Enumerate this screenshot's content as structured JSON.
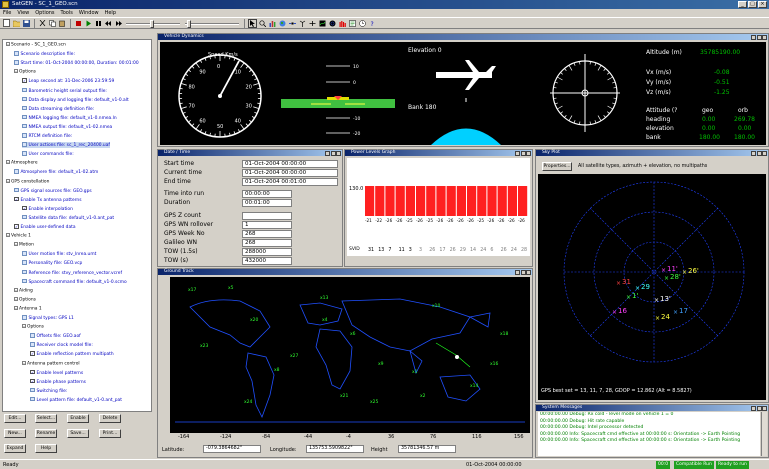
{
  "window": {
    "title": "SatGEN - SC_1_GEO.scn",
    "min": "_",
    "max": "□",
    "close": "×"
  },
  "menu": [
    "File",
    "View",
    "Options",
    "Tools",
    "Window",
    "Help"
  ],
  "tree": {
    "rows": [
      {
        "text": "Scenario - SC_1_GEO.scn",
        "indent": 0,
        "kind": "tw",
        "color": "black"
      },
      {
        "text": "Scenario description file:",
        "indent": 1,
        "kind": "leaf",
        "color": "blue"
      },
      {
        "text": "Start time: 01-Oct-2004 00:00:00, Duration: 00:01:00",
        "indent": 1,
        "kind": "leaf",
        "color": "blue"
      },
      {
        "text": "Options",
        "indent": 1,
        "kind": "tw",
        "color": "black"
      },
      {
        "text": "Leap second at: 31-Dec-2006 23:59:59",
        "indent": 2,
        "kind": "check",
        "color": "blue"
      },
      {
        "text": "Barometric height serial output file:",
        "indent": 2,
        "kind": "leaf",
        "color": "blue"
      },
      {
        "text": "Data display and logging file: default_v1-0.alt",
        "indent": 2,
        "kind": "leaf",
        "color": "blue"
      },
      {
        "text": "Data streaming definition file:",
        "indent": 2,
        "kind": "leaf",
        "color": "blue"
      },
      {
        "text": "NMEA logging file: default_v1-0.nmea.ln",
        "indent": 2,
        "kind": "leaf",
        "color": "blue"
      },
      {
        "text": "NMEA output file: default_v1-02.nmea",
        "indent": 2,
        "kind": "leaf",
        "color": "blue"
      },
      {
        "text": "RTCM definition file:",
        "indent": 2,
        "kind": "leaf",
        "color": "blue"
      },
      {
        "text": "User actions file: sc_1_rec_20400.uaf",
        "indent": 2,
        "kind": "leaf",
        "color": "blue",
        "hl": true
      },
      {
        "text": "User commands file:",
        "indent": 2,
        "kind": "leaf",
        "color": "blue"
      },
      {
        "text": "Atmosphere",
        "indent": 0,
        "kind": "tw",
        "color": "black"
      },
      {
        "text": "Atmosphere file: default_v1-02.atm",
        "indent": 1,
        "kind": "leaf",
        "color": "blue"
      },
      {
        "text": "GPS constellation",
        "indent": 0,
        "kind": "tw",
        "color": "black"
      },
      {
        "text": "GPS signal sources file: GEO.gps",
        "indent": 1,
        "kind": "leaf",
        "color": "blue"
      },
      {
        "text": "Enable Tx antenna patterns",
        "indent": 1,
        "kind": "check",
        "color": "blue"
      },
      {
        "text": "Enable interpolation",
        "indent": 2,
        "kind": "check",
        "color": "blue"
      },
      {
        "text": "Satellite data file: default_v1-0.ant_pat",
        "indent": 2,
        "kind": "leaf",
        "color": "blue"
      },
      {
        "text": "Enable user-defined data",
        "indent": 1,
        "kind": "check",
        "color": "blue"
      },
      {
        "text": "Vehicle 1",
        "indent": 0,
        "kind": "tw",
        "color": "black"
      },
      {
        "text": "Motion",
        "indent": 1,
        "kind": "tw",
        "color": "black"
      },
      {
        "text": "User motion file: stv_lnrea.umt",
        "indent": 2,
        "kind": "leaf",
        "color": "blue"
      },
      {
        "text": "Personality file: GEO.vcp",
        "indent": 2,
        "kind": "leaf",
        "color": "blue"
      },
      {
        "text": "Reference file: stvy_reference_vector.vcref",
        "indent": 2,
        "kind": "leaf",
        "color": "blue"
      },
      {
        "text": "Spacecraft command file: default_v1-0.scmo",
        "indent": 2,
        "kind": "leaf",
        "color": "blue"
      },
      {
        "text": "Aiding",
        "indent": 1,
        "kind": "tw",
        "color": "black"
      },
      {
        "text": "Options",
        "indent": 1,
        "kind": "tw",
        "color": "black"
      },
      {
        "text": "Antenna 1",
        "indent": 1,
        "kind": "tw",
        "color": "black"
      },
      {
        "text": "Signal types: GPS L1",
        "indent": 2,
        "kind": "leaf",
        "color": "blue"
      },
      {
        "text": "Options",
        "indent": 2,
        "kind": "tw",
        "color": "black"
      },
      {
        "text": "Offsets file: GEO.aof",
        "indent": 3,
        "kind": "leaf",
        "color": "blue"
      },
      {
        "text": "Receiver clock model file:",
        "indent": 3,
        "kind": "leaf",
        "color": "blue"
      },
      {
        "text": "Enable reflection pattern multipath",
        "indent": 3,
        "kind": "check",
        "color": "blue"
      },
      {
        "text": "Antenna pattern control",
        "indent": 2,
        "kind": "tw",
        "color": "black"
      },
      {
        "text": "Enable level patterns",
        "indent": 3,
        "kind": "check",
        "color": "blue"
      },
      {
        "text": "Enable phase patterns",
        "indent": 3,
        "kind": "check",
        "color": "blue"
      },
      {
        "text": "Switching file:",
        "indent": 3,
        "kind": "leaf",
        "color": "blue"
      },
      {
        "text": "Level pattern file: default_v1-0.ant_pat",
        "indent": 3,
        "kind": "leaf",
        "color": "blue"
      }
    ]
  },
  "buttons": {
    "edit": "Edit...",
    "select": "Select...",
    "enable": "Enable",
    "delete": "Delete",
    "new": "New...",
    "rename": "Rename",
    "save": "Save...",
    "print": "Print...",
    "expand": "Expand",
    "help": "Help"
  },
  "status": {
    "left": "Ready",
    "time": "01-Oct-2004 00:00:00",
    "badges": [
      "00:0",
      "Compatible Run",
      "Ready to run"
    ]
  },
  "vehicle_dynamics": {
    "title": "Vehicle Dynamics",
    "speed_label": "Speed Km/s",
    "speed_ticks": [
      "0",
      "10",
      "20",
      "30",
      "40",
      "50",
      "60",
      "70",
      "80",
      "90"
    ],
    "elevation_label": "Elevation 0",
    "bank_label": "Bank 180",
    "pitch_ladder": [
      "10",
      "0",
      "-10",
      "-20"
    ],
    "altitude_label": "Altitude (m)",
    "altitude_value": "35785190.00",
    "vx_label": "Vx (m/s)",
    "vx_value": "-0.08",
    "vy_label": "Vy (m/s)",
    "vy_value": "-0.51",
    "vz_label": "Vz (m/s)",
    "vz_value": "-1.25",
    "att_header": "Attitude (?",
    "geo": "geo",
    "orb": "orb",
    "heading_label": "heading",
    "heading_geo": "0.00",
    "heading_orb": "269.78",
    "elevation_att_label": "elevation",
    "elevation_geo": "0.00",
    "elevation_orb": "0.00",
    "bank_att_label": "bank",
    "bank_geo": "180.00",
    "bank_orb": "180.00"
  },
  "date_time": {
    "title": "Date / Time",
    "start_label": "Start time",
    "start_value": "01-Oct-2004 00:00:00",
    "current_label": "Current time",
    "current_value": "01-Oct-2004 00:00:00",
    "end_label": "End time",
    "end_value": "01-Oct-2004 00:01:00",
    "into_label": "Time into run",
    "into_value": "00:00:00",
    "duration_label": "Duration",
    "duration_value": "00:01:00",
    "gps_z_label": "GPS Z count",
    "gps_z_value": "",
    "gps_wn_ro_label": "GPS WN rollover",
    "gps_wn_ro_value": "1",
    "gps_wn_label": "GPS Week No",
    "gps_wn_value": "268",
    "galileo_label": "Galileo WN",
    "galileo_value": "268",
    "tow15_label": "TOW (1.5s)",
    "tow15_value": "288000",
    "tows_label": "TOW (s)",
    "tows_value": "432000"
  },
  "power_levels": {
    "title": "Power Levels Graph",
    "y_top": "130.0",
    "values": [
      "-21",
      "-22",
      "-26",
      "-26",
      "-25",
      "-26",
      "-25",
      "-26",
      "-26",
      "-26",
      "-26",
      "-25",
      "-26",
      "-26",
      "-26",
      "-26"
    ],
    "svid_label": "SVID",
    "svids": [
      "31",
      "13",
      "7",
      "11",
      "3",
      "3",
      "26",
      "17",
      "26",
      "29",
      "14",
      "24",
      "6",
      "26",
      "24",
      "28"
    ]
  },
  "sky_plot": {
    "title": "Sky Plot",
    "properties_button": "Properties...",
    "desc": "All satellite types, azimuth + elevation, no multipaths",
    "footer": "GPS best set = 13, 11, 7, 28, GDOP = 12.862 (Alt = 8.5827)",
    "sats": [
      {
        "label": "11'",
        "color": "#ff40ff"
      },
      {
        "label": "28'",
        "color": "#40ff40"
      },
      {
        "label": "26'",
        "color": "#ffff40"
      },
      {
        "label": "31",
        "color": "#ff4040"
      },
      {
        "label": "1'",
        "color": "#40ff40"
      },
      {
        "label": "13'",
        "color": "#ffffff"
      },
      {
        "label": "17",
        "color": "#40a0ff"
      },
      {
        "label": "24",
        "color": "#ffff40"
      },
      {
        "label": "29",
        "color": "#40ffff"
      },
      {
        "label": "16",
        "color": "#ff40ff"
      }
    ]
  },
  "ground_track": {
    "title": "Ground Track",
    "lon_ticks": [
      "-164",
      "-124",
      "-84",
      "-44",
      "-4",
      "36",
      "76",
      "116",
      "156"
    ],
    "lat_label": "Latitude:",
    "lat_value": "-079.3864682°",
    "lon_label": "Longitude:",
    "lon_value": "135753.5909822°",
    "height_label": "Height",
    "height_value": "35781346.57 m"
  },
  "messages": {
    "title": "System Messages",
    "lines": [
      "00:00:00.00 Debug: Rx cold - level mode on vehicle 1 = 0",
      "00:00:00.00 Debug: Hit rate capable",
      "00:00:00.00 Debug: Intel processor detected",
      "00:00:00.00 Info: Spacecraft cmd effective at 00:00:00 s: Orientation -> Earth Pointing",
      "00:00:00.00 Info: Spacecraft cmd effective at 00:00:00 s: Orientation -> Earth Pointing"
    ]
  }
}
